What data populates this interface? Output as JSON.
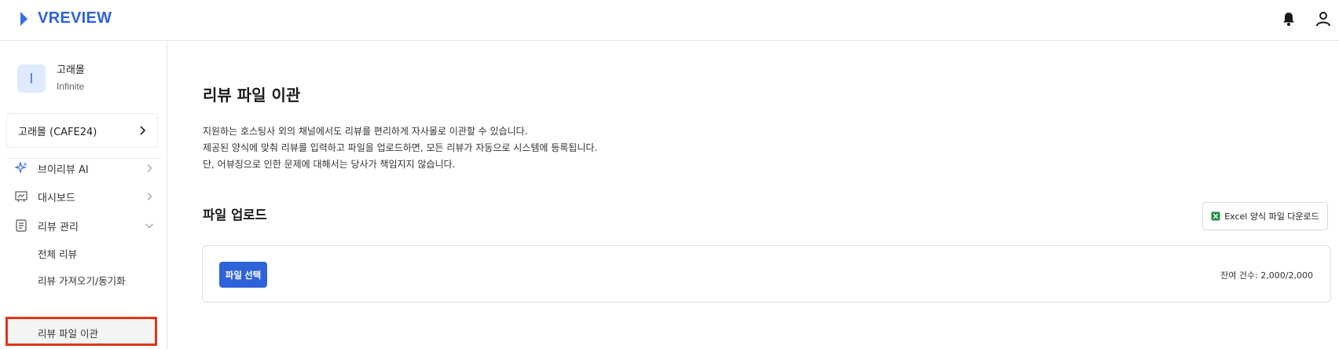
{
  "header": {
    "logo_text": "VREVIEW",
    "icons": [
      "bell-icon",
      "user-icon"
    ]
  },
  "account": {
    "avatar_initial": "I",
    "name": "고래몰",
    "plan": "Infinite"
  },
  "store": {
    "label": "고래몰 (CAFE24)"
  },
  "sidebar": {
    "items": [
      {
        "label": "브이리뷰 AI",
        "icon": "sparkle-icon"
      },
      {
        "label": "대시보드",
        "icon": "dashboard-icon"
      },
      {
        "label": "리뷰 관리",
        "icon": "document-icon"
      }
    ],
    "sub_items": [
      {
        "label": "전체 리뷰"
      },
      {
        "label": "리뷰 가져오기/동기화"
      },
      {
        "label": "리뷰 파일 이관"
      }
    ]
  },
  "main": {
    "title": "리뷰 파일 이관",
    "description": [
      "지원하는 호스팅사 외의 채널에서도 리뷰를 편리하게 자사몰로 이관할 수 있습니다.",
      "제공된 양식에 맞춰 리뷰를 입력하고 파일을 업로드하면, 모든 리뷰가 자동으로 시스템에 등록됩니다.",
      "단, 어뷰징으로 인한 문제에 대해서는 당사가 책임지지 않습니다."
    ],
    "section_title": "파일 업로드",
    "excel_button": "Excel 양식 파일 다운로드",
    "file_button": "파일 선택",
    "remaining": "잔여 건수: 2,000/2,000"
  },
  "colors": {
    "brand": "#2e62d9",
    "highlight_border": "#e0341c",
    "excel_green": "#1f8a45"
  }
}
